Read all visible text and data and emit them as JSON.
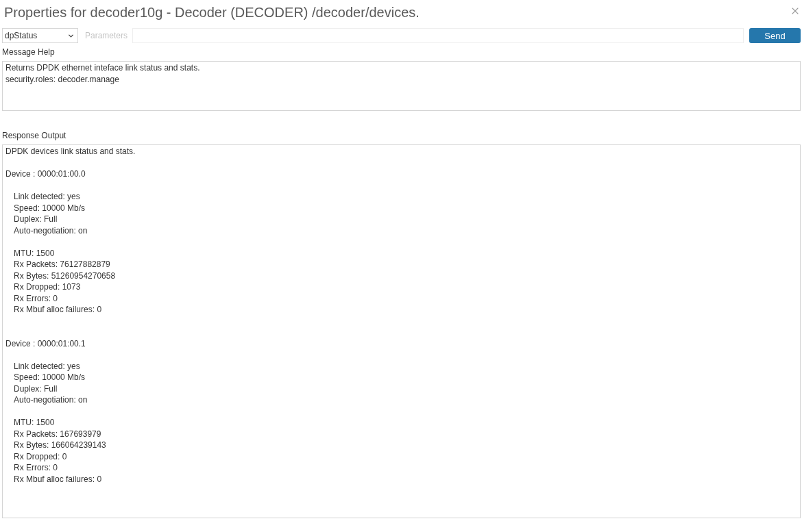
{
  "title": "Properties for decoder10g - Decoder (DECODER) /decoder/devices.",
  "toolbar": {
    "message_select": {
      "value": "dpStatus"
    },
    "parameters": {
      "label": "Parameters"
    },
    "send_button": "Send"
  },
  "message_help": {
    "label": "Message Help",
    "lines": [
      "Returns DPDK ethernet inteface link status and stats.",
      "security.roles: decoder.manage"
    ]
  },
  "response_output": {
    "label": "Response Output",
    "intro": "DPDK devices link status and stats.",
    "devices": [
      {
        "heading": "Device : 0000:01:00.0",
        "link": [
          "Link detected: yes",
          "Speed: 10000 Mb/s",
          "Duplex: Full",
          "Auto-negotiation: on"
        ],
        "stats": [
          "MTU: 1500",
          "Rx Packets: 76127882879",
          "Rx Bytes: 51260954270658",
          "Rx Dropped: 1073",
          "Rx Errors: 0",
          "Rx Mbuf alloc failures: 0"
        ]
      },
      {
        "heading": "Device : 0000:01:00.1",
        "link": [
          "Link detected: yes",
          "Speed: 10000 Mb/s",
          "Duplex: Full",
          "Auto-negotiation: on"
        ],
        "stats": [
          "MTU: 1500",
          "Rx Packets: 167693979",
          "Rx Bytes: 166064239143",
          "Rx Dropped: 0",
          "Rx Errors: 0",
          "Rx Mbuf alloc failures: 0"
        ]
      }
    ]
  }
}
